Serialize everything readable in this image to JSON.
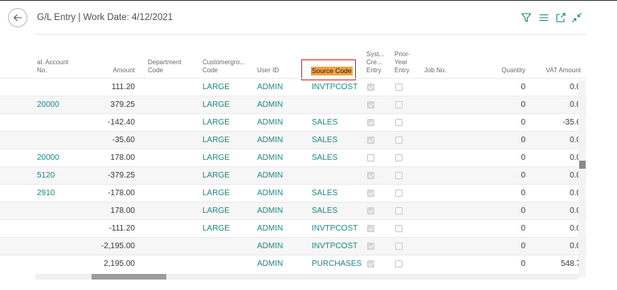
{
  "page": {
    "title": "G/L Entry | Work Date: 4/12/2021"
  },
  "header_icons": [
    "filter-icon",
    "list-view-icon",
    "open-new-window-icon",
    "collapse-icon"
  ],
  "columns": {
    "gl_account_no": "...al. Account No.",
    "gl_account_no_line1": "al. Account",
    "gl_account_no_line2": "No.",
    "amount": "Amount",
    "department_line1": "Department",
    "department_line2": "Code",
    "customergroup_line1": "Customergro...",
    "customergroup_line2": "Code",
    "user_id": "User ID",
    "source_code": "Source Code",
    "system_created_line1": "Syst...",
    "system_created_line2": "Cre...",
    "system_created_line3": "Entry",
    "prior_year_line1": "Prior-",
    "prior_year_line2": "Year",
    "prior_year_line3": "Entry",
    "job_no": "Job No.",
    "quantity": "Quantity",
    "vat_amount": "VAT Amount"
  },
  "rows": [
    {
      "gl_account": "",
      "amount": "111.20",
      "customergroup": "LARGE",
      "user_id": "ADMIN",
      "source_code": "INVTPCOST",
      "system_created": true,
      "prior_year": false,
      "quantity": "0",
      "vat_amount": "0.0"
    },
    {
      "gl_account": "20000",
      "amount": "379.25",
      "customergroup": "LARGE",
      "user_id": "ADMIN",
      "source_code": "",
      "system_created": true,
      "prior_year": false,
      "quantity": "0",
      "vat_amount": "0.0"
    },
    {
      "gl_account": "",
      "amount": "-142.40",
      "customergroup": "LARGE",
      "user_id": "ADMIN",
      "source_code": "SALES",
      "system_created": true,
      "prior_year": false,
      "quantity": "0",
      "vat_amount": "-35.6"
    },
    {
      "gl_account": "",
      "amount": "-35.60",
      "customergroup": "LARGE",
      "user_id": "ADMIN",
      "source_code": "SALES",
      "system_created": true,
      "prior_year": false,
      "quantity": "0",
      "vat_amount": "0.0"
    },
    {
      "gl_account": "20000",
      "amount": "178.00",
      "customergroup": "LARGE",
      "user_id": "ADMIN",
      "source_code": "SALES",
      "system_created": false,
      "prior_year": false,
      "quantity": "0",
      "vat_amount": "0.0"
    },
    {
      "gl_account": "5120",
      "amount": "-379.25",
      "customergroup": "LARGE",
      "user_id": "ADMIN",
      "source_code": "",
      "system_created": true,
      "prior_year": false,
      "quantity": "0",
      "vat_amount": "0.0"
    },
    {
      "gl_account": "2910",
      "amount": "-178.00",
      "customergroup": "LARGE",
      "user_id": "ADMIN",
      "source_code": "SALES",
      "system_created": true,
      "prior_year": false,
      "quantity": "0",
      "vat_amount": "0.0"
    },
    {
      "gl_account": "",
      "amount": "178.00",
      "customergroup": "LARGE",
      "user_id": "ADMIN",
      "source_code": "SALES",
      "system_created": true,
      "prior_year": false,
      "quantity": "0",
      "vat_amount": "0.0"
    },
    {
      "gl_account": "",
      "amount": "-111.20",
      "customergroup": "LARGE",
      "user_id": "ADMIN",
      "source_code": "INVTPCOST",
      "system_created": true,
      "prior_year": false,
      "quantity": "0",
      "vat_amount": "0.0"
    },
    {
      "gl_account": "",
      "amount": "-2,195.00",
      "customergroup": "",
      "user_id": "ADMIN",
      "source_code": "INVTPCOST",
      "system_created": true,
      "prior_year": false,
      "quantity": "0",
      "vat_amount": "0.0"
    },
    {
      "gl_account": "",
      "amount": "2,195.00",
      "customergroup": "",
      "user_id": "ADMIN",
      "source_code": "PURCHASES",
      "system_created": true,
      "prior_year": false,
      "quantity": "0",
      "vat_amount": "548.7"
    }
  ],
  "colors": {
    "link": "#1f8a86",
    "highlight_border": "#e0241d",
    "highlight_fill": "#f4a240"
  }
}
